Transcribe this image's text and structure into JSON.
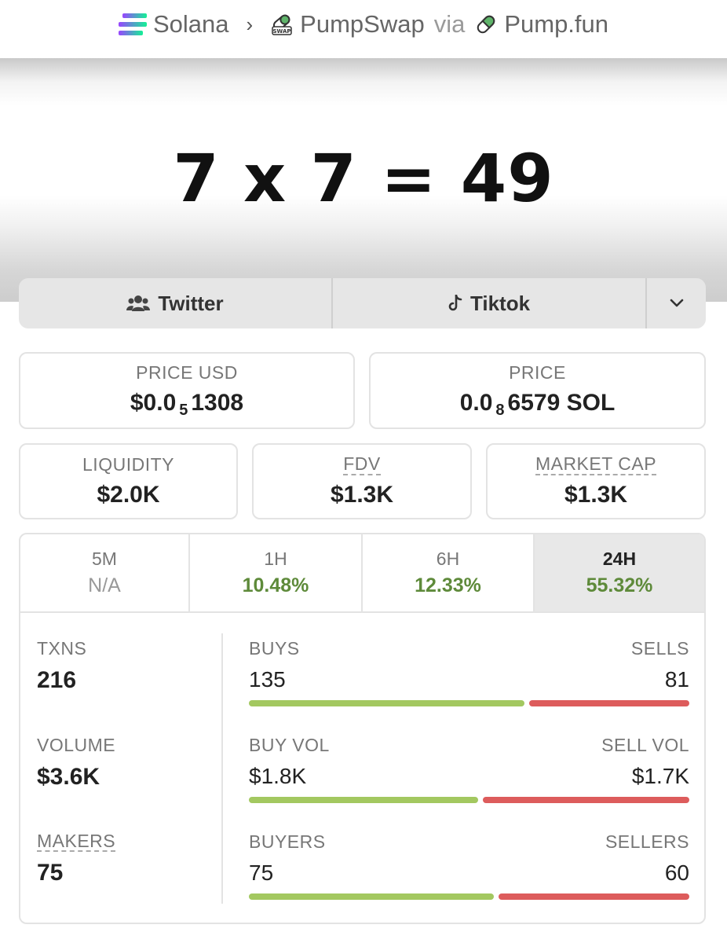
{
  "breadcrumb": {
    "chain": "Solana",
    "separator": "›",
    "dex": "PumpSwap",
    "via": "via",
    "launchpad": "Pump.fun"
  },
  "banner": {
    "text": "7 x 7 = 49"
  },
  "socials": {
    "twitter": "Twitter",
    "tiktok": "Tiktok"
  },
  "prices": {
    "usd_label": "PRICE USD",
    "usd_prefix": "$0.0",
    "usd_zeros": "5",
    "usd_digits": "1308",
    "native_label": "PRICE",
    "native_prefix": "0.0",
    "native_zeros": "8",
    "native_digits": "6579 SOL"
  },
  "metrics": {
    "liquidity_label": "LIQUIDITY",
    "liquidity_value": "$2.0K",
    "fdv_label": "FDV",
    "fdv_value": "$1.3K",
    "mcap_label": "MARKET CAP",
    "mcap_value": "$1.3K"
  },
  "tabs": [
    {
      "label": "5M",
      "value": "N/A"
    },
    {
      "label": "1H",
      "value": "10.48%"
    },
    {
      "label": "6H",
      "value": "12.33%"
    },
    {
      "label": "24H",
      "value": "55.32%",
      "active": true
    }
  ],
  "stats": {
    "txns_label": "TXNS",
    "txns_value": "216",
    "volume_label": "VOLUME",
    "volume_value": "$3.6K",
    "makers_label": "MAKERS",
    "makers_value": "75"
  },
  "splits": [
    {
      "left_label": "BUYS",
      "right_label": "SELLS",
      "left_value": "135",
      "right_value": "81",
      "buy_fraction": 0.625
    },
    {
      "left_label": "BUY VOL",
      "right_label": "SELL VOL",
      "left_value": "$1.8K",
      "right_value": "$1.7K",
      "buy_fraction": 0.52
    },
    {
      "left_label": "BUYERS",
      "right_label": "SELLERS",
      "left_value": "75",
      "right_value": "60",
      "buy_fraction": 0.556
    }
  ],
  "colors": {
    "positive": "#5e8a3a",
    "buy_bar": "#a3c860",
    "sell_bar": "#dd5c5c"
  },
  "icons": [
    "solana-logo-icon",
    "chevron-right-icon",
    "pumpswap-logo-icon",
    "pill-icon",
    "users-icon",
    "tiktok-icon",
    "chevron-down-icon"
  ]
}
